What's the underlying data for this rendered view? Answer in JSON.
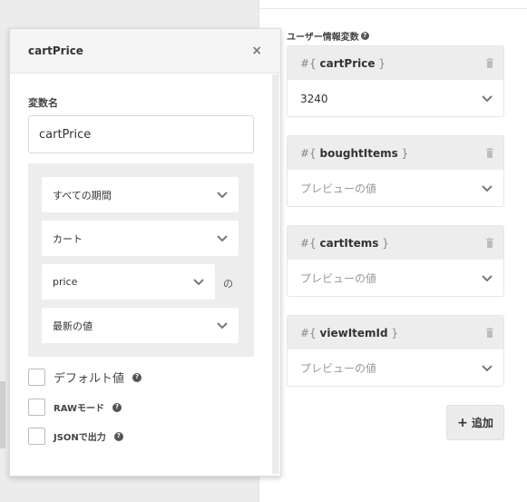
{
  "panel": {
    "title": "cartPrice",
    "variable_name_label": "変数名",
    "variable_name_value": "cartPrice",
    "period_select": "すべての期間",
    "source_select": "カート",
    "field_select": "price",
    "no_suffix": "の",
    "value_select": "最新の値",
    "checkboxes": [
      {
        "label": "デフォルト値",
        "has_help": true
      },
      {
        "label": "RAWモード",
        "has_help": true
      },
      {
        "label": "JSONで出力",
        "has_help": true
      }
    ]
  },
  "user_vars": {
    "section_title": "ユーザー情報変数",
    "cards": [
      {
        "prefix": "#{",
        "name": "cartPrice",
        "suffix": "}",
        "value": "3240",
        "is_placeholder": false
      },
      {
        "prefix": "#{",
        "name": "boughtItems",
        "suffix": "}",
        "value": "プレビューの値",
        "is_placeholder": true
      },
      {
        "prefix": "#{",
        "name": "cartItems",
        "suffix": "}",
        "value": "プレビューの値",
        "is_placeholder": true
      },
      {
        "prefix": "#{",
        "name": "viewItemId",
        "suffix": "}",
        "value": "プレビューの値",
        "is_placeholder": true
      }
    ],
    "add_button": "追加"
  },
  "icons": {
    "close": "close-icon",
    "help": "question-circle-icon",
    "trash": "trash-icon",
    "chevron": "chevron-down-icon",
    "plus": "plus-icon"
  }
}
